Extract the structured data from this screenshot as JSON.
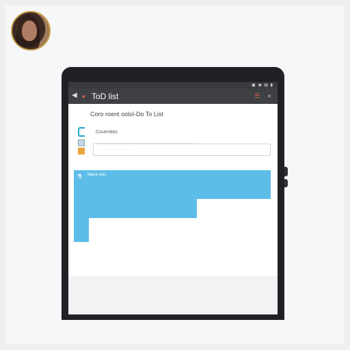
{
  "window": {
    "title": "ToD list"
  },
  "statusbar": {
    "icons": "▣ ◉ ▤  ▮"
  },
  "toolbar": {
    "back_icon": "◀",
    "app_icon": "♥",
    "action_icon": "☰",
    "close_icon": "✕"
  },
  "content": {
    "heading": "Coro roent oolol-Do To List",
    "item_label": "Courmtios",
    "input_hint": "—— —— ——— ——— ——— ——— ——— ——— ——— ——— ——",
    "input_placeholder": "· · · · · · · · · · · · · · ·"
  },
  "highlight": {
    "label": "Itlana stus",
    "icon": "⚗"
  },
  "colors": {
    "accent_blue": "#5dbde9",
    "toolbar": "#3f4043",
    "tablet_frame": "#202124",
    "action_orange": "#e06a4c"
  }
}
